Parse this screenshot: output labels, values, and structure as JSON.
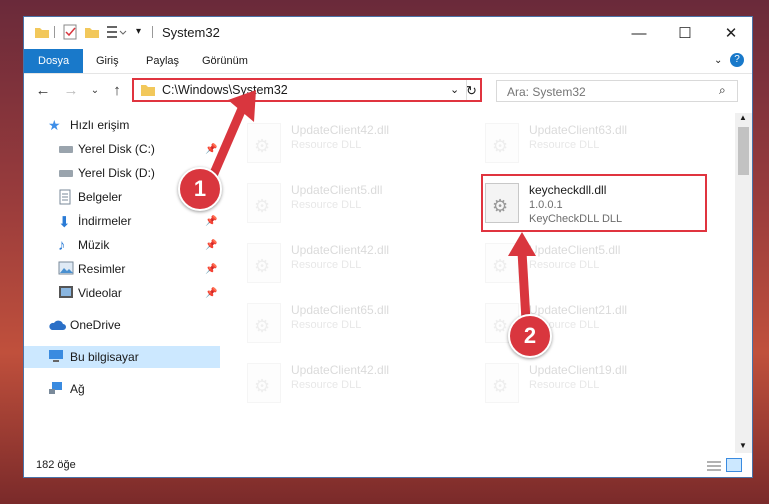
{
  "window": {
    "title": "System32"
  },
  "ribbon": {
    "tabs": [
      "Dosya",
      "Giriş",
      "Paylaş",
      "Görünüm"
    ]
  },
  "address": {
    "path": "C:\\Windows\\System32"
  },
  "search": {
    "placeholder": "Ara: System32"
  },
  "sidebar": {
    "items": [
      {
        "label": "Hızlı erişim",
        "icon": "star-icon"
      },
      {
        "label": "Yerel Disk (C:)",
        "icon": "drive-icon"
      },
      {
        "label": "Yerel Disk (D:)",
        "icon": "drive-icon"
      },
      {
        "label": "Belgeler",
        "icon": "documents-icon"
      },
      {
        "label": "İndirmeler",
        "icon": "download-icon"
      },
      {
        "label": "Müzik",
        "icon": "music-icon"
      },
      {
        "label": "Resimler",
        "icon": "pictures-icon"
      },
      {
        "label": "Videolar",
        "icon": "video-icon"
      },
      {
        "label": "OneDrive",
        "icon": "cloud-icon"
      },
      {
        "label": "Bu bilgisayar",
        "icon": "computer-icon"
      },
      {
        "label": "Ağ",
        "icon": "network-icon"
      }
    ]
  },
  "files": [
    {
      "name": "UpdateClient42.dll",
      "desc": "Resource DLL"
    },
    {
      "name": "UpdateClient63.dll",
      "desc": "Resource DLL"
    },
    {
      "name": "UpdateClient5.dll",
      "desc": "Resource DLL"
    },
    {
      "name": "keycheckdll.dll",
      "version": "1.0.0.1",
      "desc": "KeyCheckDLL DLL"
    },
    {
      "name": "UpdateClient42.dll",
      "desc": "Resource DLL"
    },
    {
      "name": "UpdateClient5.dll",
      "desc": "Resource DLL"
    },
    {
      "name": "UpdateClient65.dll",
      "desc": "Resource DLL"
    },
    {
      "name": "UpdateClient21.dll",
      "desc": "Resource DLL"
    },
    {
      "name": "UpdateClient42.dll",
      "desc": "Resource DLL"
    },
    {
      "name": "UpdateClient19.dll",
      "desc": "Resource DLL"
    }
  ],
  "status": {
    "count": "182 öğe"
  },
  "annotations": {
    "step1": "1",
    "step2": "2"
  },
  "colors": {
    "highlight": "#e0343f",
    "accent": "#1979ca",
    "selection": "#cce8ff"
  }
}
